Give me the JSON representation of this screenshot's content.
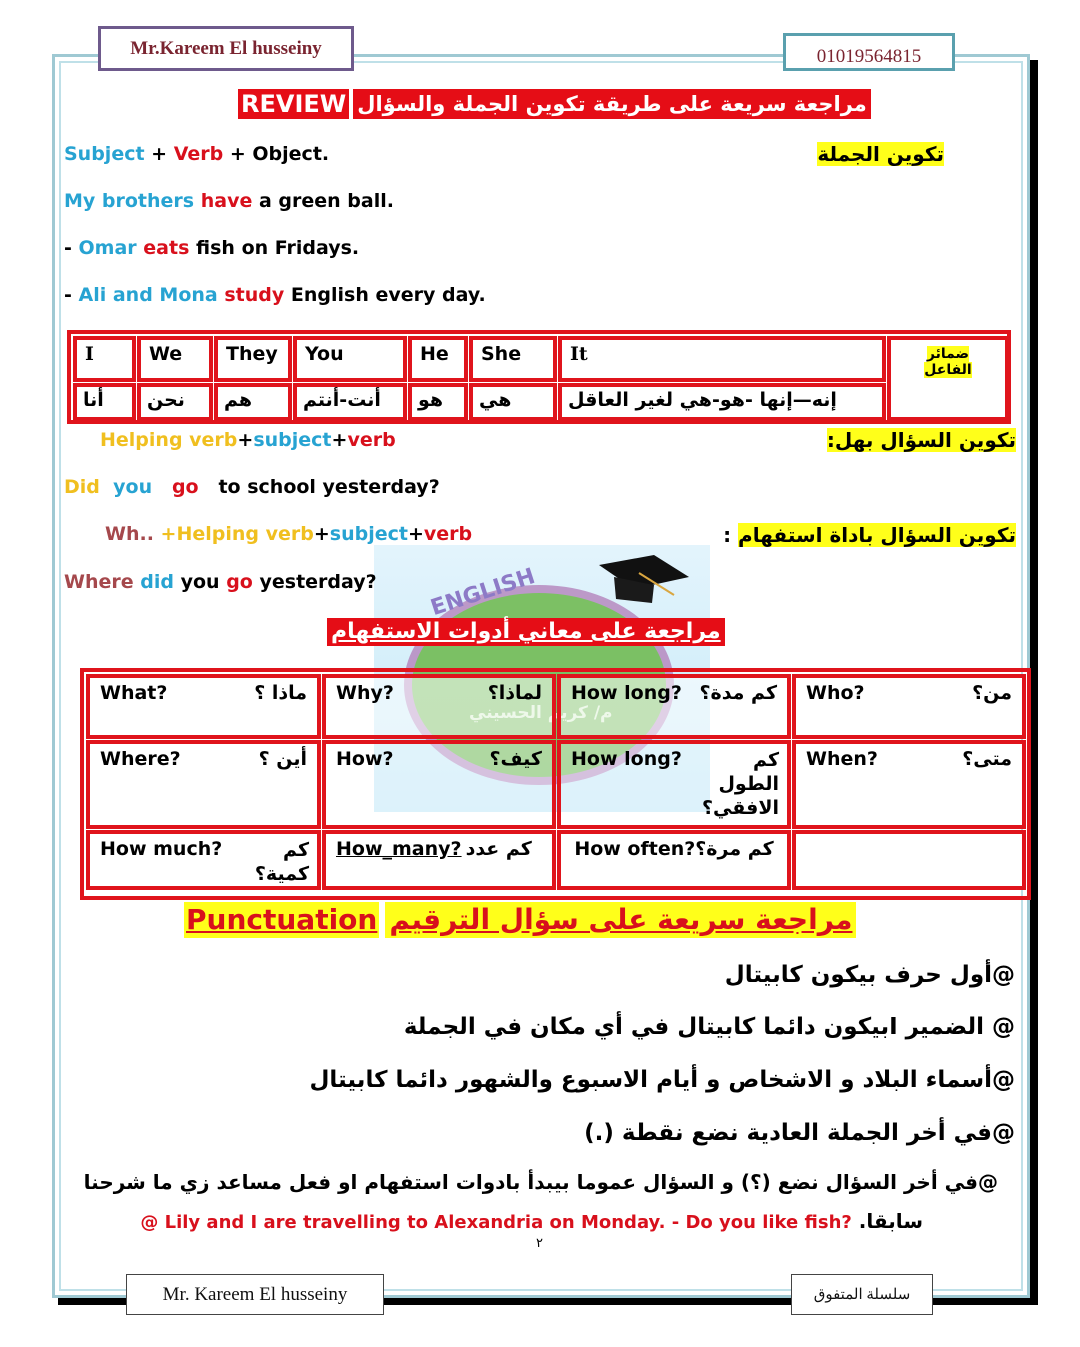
{
  "header": {
    "author_tag": "Mr.Kareem El husseiny",
    "phone": "01019564815"
  },
  "title": {
    "en": "REVIEW",
    "ar": "مراجعة سريعة على طريقة تكوين الجملة والسؤال"
  },
  "sentence_structure": {
    "label_ar": "تكوين الجملة",
    "formula": {
      "subject": "Subject",
      "plus1": " + ",
      "verb": "Verb",
      "plus2": " + ",
      "object": "Object."
    },
    "examples": [
      {
        "prefix": "",
        "subject": "My brothers",
        "verb": "have",
        "rest": "a green ball."
      },
      {
        "prefix": "- ",
        "subject": "Omar",
        "verb": "eats",
        "rest": "fish on Fridays."
      },
      {
        "prefix": "- ",
        "subject": "Ali and Mona",
        "verb": "study",
        "rest": "English every day."
      }
    ]
  },
  "pronouns": {
    "header_ar": [
      "ضمائر",
      "الفاعل"
    ],
    "items": [
      {
        "en": "I",
        "ar": "أنا"
      },
      {
        "en": "We",
        "ar": "نحن"
      },
      {
        "en": "They",
        "ar": "هم"
      },
      {
        "en": "You",
        "ar": "أنت-أنتم"
      },
      {
        "en": "He",
        "ar": "هو"
      },
      {
        "en": "She",
        "ar": "هي"
      },
      {
        "en": "It",
        "ar": "إنه—إنها -هو-هي لغير العاقل"
      }
    ]
  },
  "yes_no_question": {
    "label_ar": "تكوين السؤال بهل:",
    "formula": {
      "helping": "Helping verb",
      "plus1": "+",
      "subject": "subject",
      "plus2": "+",
      "verb": "verb"
    },
    "example": {
      "helping": "Did",
      "subject": "you",
      "verb": "go",
      "rest": "to school yesterday?"
    }
  },
  "wh_question": {
    "label_ar": "تكوين السؤال باداة استفهام",
    "colon": ":",
    "formula": {
      "wh": "Wh.. ",
      "helping": "+Helping verb",
      "plus1": "+",
      "subject": "subject",
      "plus2": "+",
      "verb": "verb"
    },
    "example": {
      "wh": "Where",
      "helping": "did",
      "subject": "you",
      "verb": "go",
      "rest": "yesterday?"
    }
  },
  "watermark": {
    "badge": "ENGLISH",
    "name_ar": "م/ كريم الحسيني"
  },
  "question_words": {
    "title_ar": "مراجعة على معاني أدوات الاستفهام",
    "rows": [
      [
        {
          "en": "What?",
          "ar": "ماذا ؟"
        },
        {
          "en": "Why?",
          "ar": "لماذا؟"
        },
        {
          "en": "How long?",
          "ar": "كم مدة؟"
        },
        {
          "en": "Who?",
          "ar": "من؟"
        }
      ],
      [
        {
          "en": "Where?",
          "ar": "أين ؟"
        },
        {
          "en": "How?",
          "ar": "كيف؟"
        },
        {
          "en": "How long?",
          "ar": "كم الطول الافقي؟"
        },
        {
          "en": "When?",
          "ar": "متى؟"
        }
      ],
      [
        {
          "en": "How much?",
          "ar": "كم كمية؟"
        },
        {
          "en": "How_many?",
          "ar": "كم عدد"
        },
        {
          "en": "How often?",
          "ar": "كم مرة؟"
        },
        {
          "en": "",
          "ar": ""
        }
      ]
    ]
  },
  "punctuation": {
    "title_en": "Punctuation",
    "title_ar": "مراجعة سريعة على سؤال الترقيم",
    "rules": [
      "@أول حرف بيكون كابيتال",
      "@ الضمير  Iبيكون دائما كابيتال في أي مكان في الجملة",
      "@أسماء البلاد و الاشخاص و أيام الاسبوع والشهور دائما كابيتال",
      "@في أخر الجملة العادية نضع نقطة (.)",
      "@في أخر السؤال نضع (؟) و السؤال عموما بيبدأ بادوات استفهام او فعل مساعد زي ما شرحنا"
    ],
    "last_line_ar": "سابقا.",
    "examples_en": "@ Lily and I are travelling to Alexandria on Monday. - Do you like fish?"
  },
  "footer": {
    "page_number": "٢",
    "author_tag": "Mr. Kareem El husseiny",
    "series_ar": "سلسلة المتفوق"
  }
}
